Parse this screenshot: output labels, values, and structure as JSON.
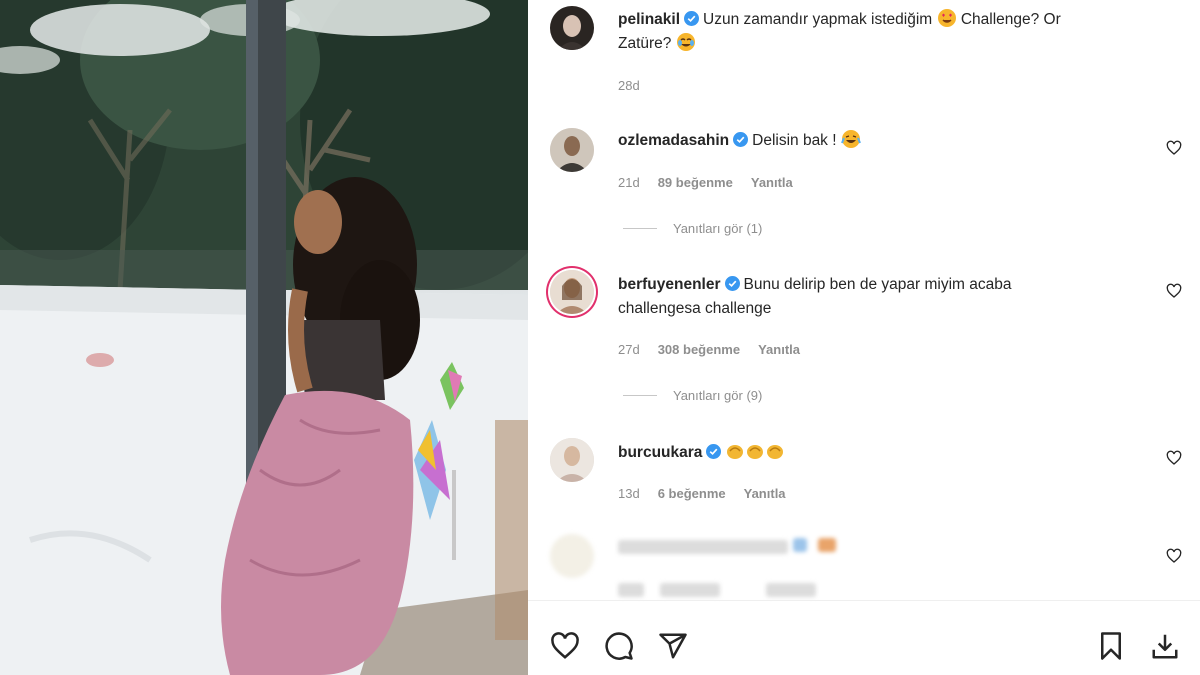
{
  "post": {
    "author": "pelinakil",
    "caption_part1": "Uzun zamandır yapmak istediğim",
    "caption_part2": "Challenge? Or",
    "caption_line2": "Zatüre?",
    "caption_emoji_1": "heart-eyes-emoji",
    "caption_emoji_2": "tears-of-joy-emoji",
    "time": "28d"
  },
  "comments": [
    {
      "username": "ozlemadasahin",
      "text": "Delisin bak !",
      "emoji": "loudly-laughing-emoji",
      "time": "21d",
      "likes": "89 beğenme",
      "reply_label": "Yanıtla",
      "view_replies": "Yanıtları gör (1)"
    },
    {
      "username": "berfuyenenler",
      "text_line1": "Bunu delirip ben de yapar miyim acaba",
      "text_line2": "challengesa challenge",
      "time": "27d",
      "likes": "308 beğenme",
      "reply_label": "Yanıtla",
      "view_replies": "Yanıtları gör (9)"
    },
    {
      "username": "burcuukara",
      "emoji": "clapping-hands-emoji x3",
      "time": "13d",
      "likes": "6 beğenme",
      "reply_label": "Yanıtla"
    }
  ],
  "icons": {
    "like": "heart-icon",
    "comment": "comment-icon",
    "share": "send-icon",
    "save": "bookmark-icon",
    "download": "download-icon"
  },
  "colors": {
    "verified": "#3897f0",
    "story_ring": "#e1306c",
    "text_secondary": "#8e8e8e"
  }
}
